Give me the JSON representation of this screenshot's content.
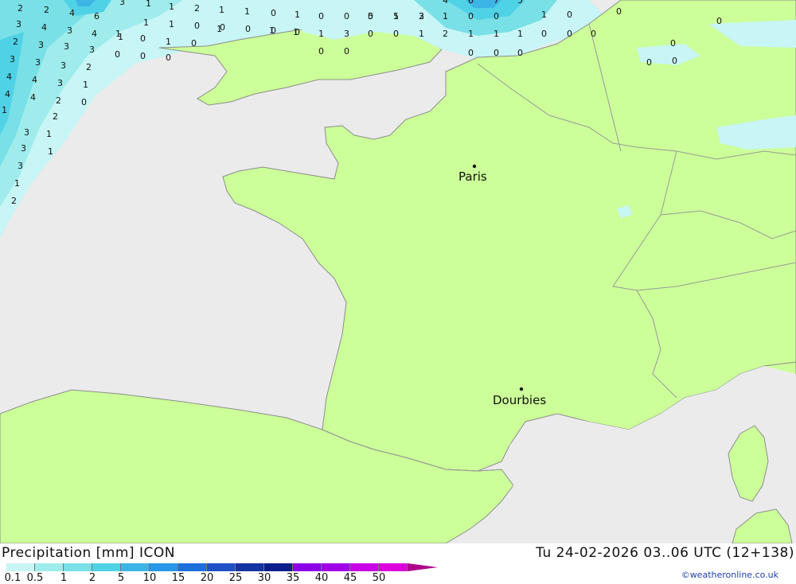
{
  "map": {
    "colors": {
      "sea": "#ebebeb",
      "land": "#ccff99",
      "border": "#9a9a9a",
      "coast": "#8c8c8c"
    },
    "cities": [
      {
        "name": "Paris"
      },
      {
        "name": "Dourbies"
      }
    ],
    "field_values_north_sea_channel": [
      "2",
      "2",
      "4",
      "6",
      "3",
      "1",
      "1",
      "2",
      "1",
      "1",
      "0",
      "1",
      "0",
      "0",
      "0",
      "1",
      "2",
      "4",
      "6",
      "7",
      "5",
      "3",
      "4",
      "3",
      "4",
      "1",
      "1",
      "1",
      "0",
      "0",
      "0",
      "0",
      "0",
      "1",
      "3",
      "5",
      "5",
      "3",
      "1",
      "0",
      "0",
      "2",
      "3",
      "3",
      "3",
      "1",
      "0",
      "1",
      "0",
      "1",
      "1",
      "1",
      "0",
      "0",
      "0",
      "0",
      "1",
      "2",
      "1",
      "1",
      "1",
      "0",
      "0",
      "0",
      "3",
      "3",
      "3",
      "2",
      "0",
      "0",
      "0",
      "0",
      "0",
      "0",
      "1",
      "0",
      "0",
      "0",
      "4",
      "4",
      "3",
      "1",
      "0",
      "0",
      "4",
      "4",
      "2",
      "0",
      "0",
      "3",
      "2",
      "1",
      "3",
      "1",
      "3",
      "1",
      "2",
      "1"
    ]
  },
  "footer": {
    "title_left": "Precipitation [mm] ICON",
    "title_right": "Tu 24-02-2026 03..06 UTC (12+138)",
    "credit": "©weatheronline.co.uk",
    "legend": {
      "colors": [
        "#c8f5f5",
        "#a0ecec",
        "#78e0e6",
        "#50d2e6",
        "#3cb4e6",
        "#2896e6",
        "#1e6edc",
        "#1e50c8",
        "#1432a0",
        "#0a1e8c",
        "#8c00e6",
        "#a000e6",
        "#c800e6",
        "#dc00dc",
        "#b0008c"
      ],
      "ticks": [
        "0.1",
        "0.5",
        "1",
        "2",
        "5",
        "10",
        "15",
        "20",
        "25",
        "30",
        "35",
        "40",
        "45",
        "50"
      ]
    }
  }
}
